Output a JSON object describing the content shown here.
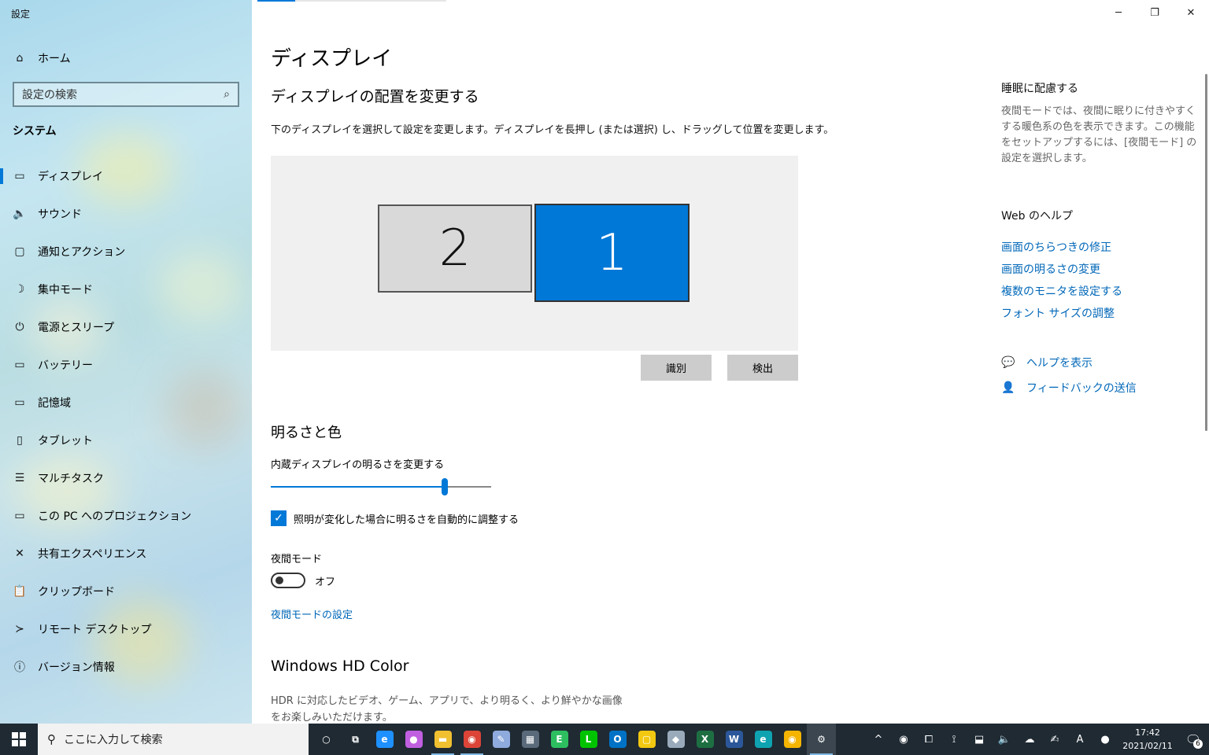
{
  "window": {
    "title": "設定",
    "controls": [
      "─",
      "❐",
      "✕"
    ]
  },
  "sidebar": {
    "home": "ホーム",
    "search_placeholder": "設定の検索",
    "section": "システム",
    "items": [
      {
        "label": "ディスプレイ",
        "icon": "monitor-icon",
        "glyph": "▭",
        "active": true
      },
      {
        "label": "サウンド",
        "icon": "speaker-icon",
        "glyph": "🔈",
        "active": false
      },
      {
        "label": "通知とアクション",
        "icon": "notification-icon",
        "glyph": "▢",
        "active": false
      },
      {
        "label": "集中モード",
        "icon": "moon-icon",
        "glyph": "☽",
        "active": false
      },
      {
        "label": "電源とスリープ",
        "icon": "power-icon",
        "glyph": "⏻",
        "active": false
      },
      {
        "label": "バッテリー",
        "icon": "battery-icon",
        "glyph": "▭",
        "active": false
      },
      {
        "label": "記憶域",
        "icon": "storage-icon",
        "glyph": "▭",
        "active": false
      },
      {
        "label": "タブレット",
        "icon": "tablet-icon",
        "glyph": "▯",
        "active": false
      },
      {
        "label": "マルチタスク",
        "icon": "multitask-icon",
        "glyph": "☰",
        "active": false
      },
      {
        "label": "この PC へのプロジェクション",
        "icon": "projection-icon",
        "glyph": "▭",
        "active": false
      },
      {
        "label": "共有エクスペリエンス",
        "icon": "shared-icon",
        "glyph": "✕",
        "active": false
      },
      {
        "label": "クリップボード",
        "icon": "clipboard-icon",
        "glyph": "📋",
        "active": false
      },
      {
        "label": "リモート デスクトップ",
        "icon": "remote-icon",
        "glyph": "≻",
        "active": false
      },
      {
        "label": "バージョン情報",
        "icon": "info-icon",
        "glyph": "ⓘ",
        "active": false
      }
    ]
  },
  "main": {
    "title": "ディスプレイ",
    "arrange_heading": "ディスプレイの配置を変更する",
    "arrange_desc": "下のディスプレイを選択して設定を変更します。ディスプレイを長押し (または選択) し、ドラッグして位置を変更します。",
    "monitor_2": "2",
    "monitor_1": "1",
    "identify_button": "識別",
    "detect_button": "検出",
    "brightness_heading": "明るさと色",
    "brightness_label": "内蔵ディスプレイの明るさを変更する",
    "brightness_value": 0.79,
    "auto_brightness_label": "照明が変化した場合に明るさを自動的に調整する",
    "auto_brightness_checked": true,
    "night_mode_label": "夜間モード",
    "night_mode_state": "オフ",
    "night_mode_link": "夜間モードの設定",
    "hd_title": "Windows HD Color",
    "hd_desc": "HDR に対応したビデオ、ゲーム、アプリで、より明るく、より鮮やかな画像をお楽しみいただけます。"
  },
  "right_pane": {
    "sleep_title": "睡眠に配慮する",
    "sleep_text": "夜間モードでは、夜間に眠りに付きやすくする暖色系の色を表示できます。この機能をセットアップするには、[夜間モード] の設定を選択します。",
    "web_help_title": "Web のヘルプ",
    "links": [
      "画面のちらつきの修正",
      "画面の明るさの変更",
      "複数のモニタを設定する",
      "フォント サイズの調整"
    ],
    "help_action": "ヘルプを表示",
    "feedback_action": "フィードバックの送信"
  },
  "taskbar": {
    "search_placeholder": "ここに入力して検索",
    "apps": [
      {
        "name": "cortana-icon",
        "glyph": "○",
        "color": "transparent"
      },
      {
        "name": "task-view-icon",
        "glyph": "⧉",
        "color": "transparent"
      },
      {
        "name": "internet-explorer-icon",
        "glyph": "e",
        "color": "#1e90ff"
      },
      {
        "name": "paint-drop-icon",
        "glyph": "●",
        "color": "#c060e0"
      },
      {
        "name": "file-explorer-icon",
        "glyph": "▬",
        "color": "#f0c030"
      },
      {
        "name": "chrome-icon",
        "glyph": "◉",
        "color": "#db4437"
      },
      {
        "name": "paint-icon",
        "glyph": "✎",
        "color": "#8faadc"
      },
      {
        "name": "calculator-icon",
        "glyph": "▦",
        "color": "#5a6a7a"
      },
      {
        "name": "evernote-icon",
        "glyph": "E",
        "color": "#2dbe60"
      },
      {
        "name": "line-icon",
        "glyph": "L",
        "color": "#00c300"
      },
      {
        "name": "outlook-icon",
        "glyph": "O",
        "color": "#0072c6"
      },
      {
        "name": "sticky-notes-icon",
        "glyph": "▢",
        "color": "#f2c811"
      },
      {
        "name": "notes-icon",
        "glyph": "◆",
        "color": "#9ab"
      },
      {
        "name": "excel-icon",
        "glyph": "X",
        "color": "#1d6f42"
      },
      {
        "name": "word-icon",
        "glyph": "W",
        "color": "#2b579a"
      },
      {
        "name": "edge-icon",
        "glyph": "e",
        "color": "#0fa3b1"
      },
      {
        "name": "chrome-canary-icon",
        "glyph": "◉",
        "color": "#f4b400"
      },
      {
        "name": "settings-icon",
        "glyph": "⚙",
        "color": "transparent"
      }
    ],
    "tray": [
      "^",
      "◉",
      "⧠",
      "⟟",
      "⬓",
      "🔈",
      "☁",
      "✍",
      "A",
      "●"
    ],
    "time": "17:42",
    "date": "2021/02/11",
    "notification_count": "6"
  }
}
